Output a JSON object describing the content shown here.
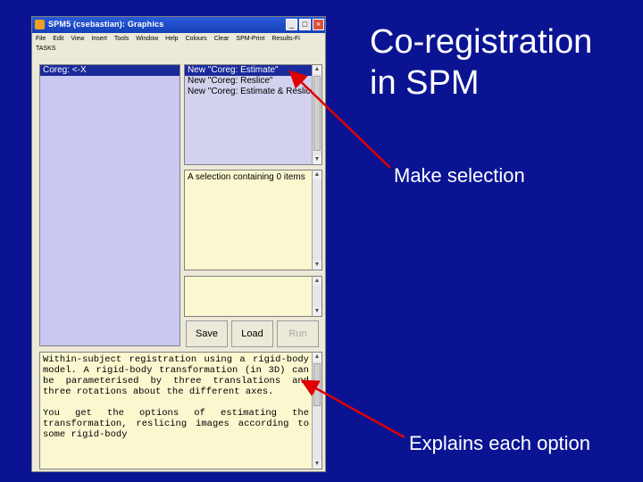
{
  "slide": {
    "title_line1": "Co-registration",
    "title_line2": "in SPM",
    "callout_selection": "Make selection",
    "callout_explains": "Explains each option",
    "arrow_color": "#e00000",
    "background": "#0a1493"
  },
  "window": {
    "title": "SPM5 (csebastian): Graphics",
    "controls": {
      "minimize": "_",
      "maximize": "□",
      "close": "×"
    },
    "menu": [
      "File",
      "Edit",
      "View",
      "Insert",
      "Tools",
      "Window",
      "Help",
      "Colours",
      "Clear",
      "SPM-Print",
      "Results-Fi"
    ],
    "tasks_label": "TASKS"
  },
  "left_list": {
    "items": [
      "Coreg: <-X"
    ]
  },
  "options_list": {
    "items": [
      "New \"Coreg: Estimate\"",
      "New \"Coreg: Reslice\"",
      "New \"Coreg: Estimate & Reslice\""
    ]
  },
  "info_box": {
    "text": "A selection containing 0 items"
  },
  "buttons": {
    "save": "Save",
    "load": "Load",
    "run": "Run"
  },
  "help": {
    "para1": "Within-subject registration using a rigid-body model. A rigid-body transformation (in 3D) can be parameterised by three translations and three rotations about the different axes.",
    "para2": "You get the options of estimating the transformation, reslicing images according to some rigid-body"
  }
}
